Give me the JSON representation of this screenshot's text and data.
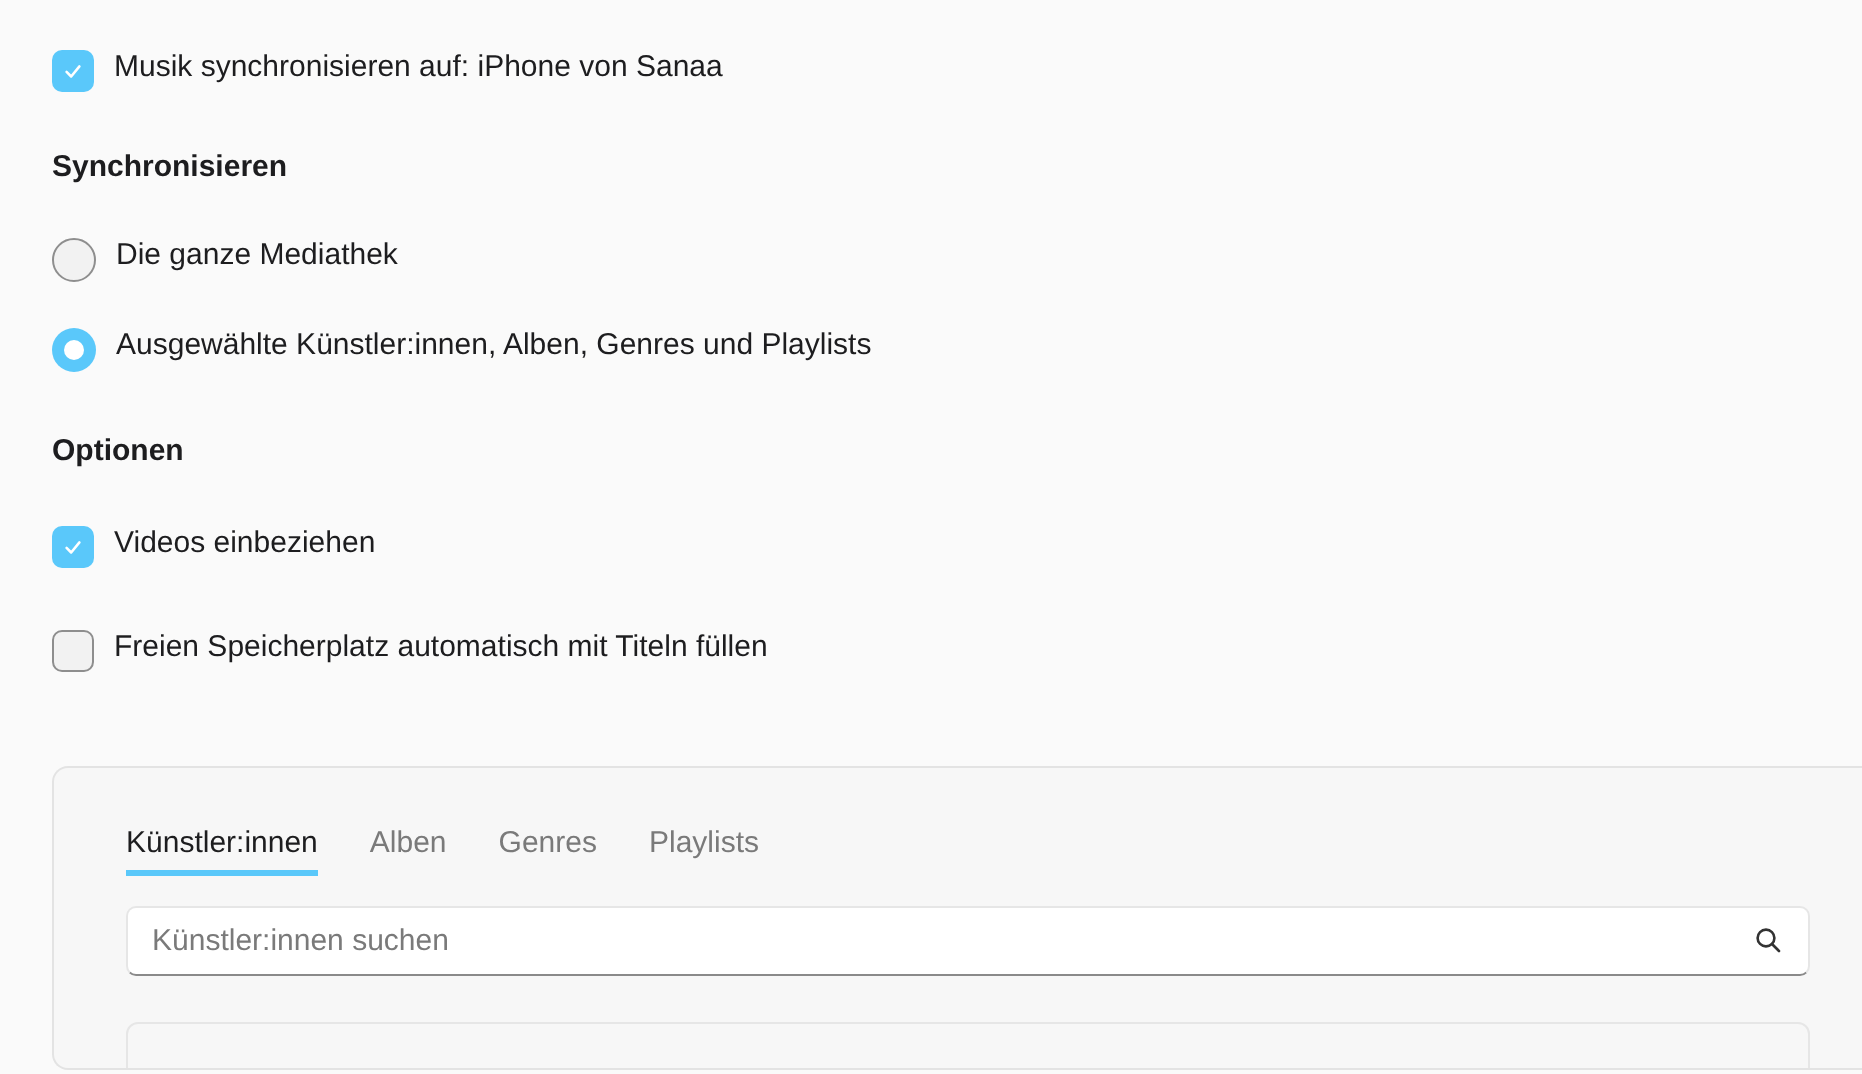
{
  "sync_music": {
    "label": "Musik synchronisieren auf: iPhone von Sanaa",
    "checked": true
  },
  "sync_section": {
    "heading": "Synchronisieren",
    "options": [
      {
        "label": "Die ganze Mediathek",
        "selected": false
      },
      {
        "label": "Ausgewählte Künstler:innen, Alben, Genres und Playlists",
        "selected": true
      }
    ]
  },
  "options_section": {
    "heading": "Optionen",
    "items": [
      {
        "label": "Videos einbeziehen",
        "checked": true
      },
      {
        "label": "Freien Speicherplatz automatisch mit Titeln füllen",
        "checked": false
      }
    ]
  },
  "browser": {
    "tabs": [
      {
        "label": "Künstler:innen",
        "selected": true
      },
      {
        "label": "Alben",
        "selected": false
      },
      {
        "label": "Genres",
        "selected": false
      },
      {
        "label": "Playlists",
        "selected": false
      }
    ],
    "search": {
      "placeholder": "Künstler:innen suchen"
    }
  }
}
